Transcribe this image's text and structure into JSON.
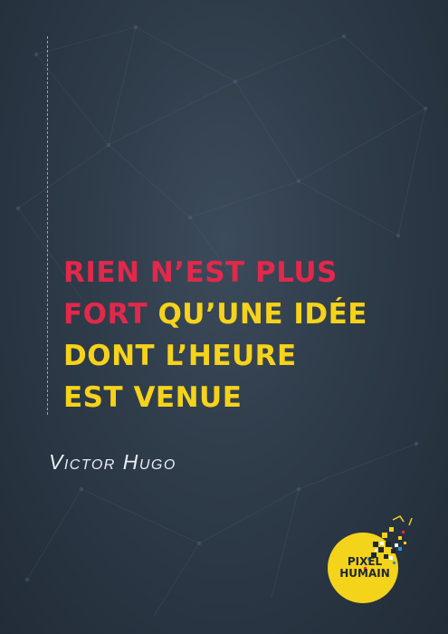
{
  "quote": {
    "line1_red": "RIEN N’EST PLUS",
    "line2_red": "FORT",
    "line2_yellow": " QU’UNE IDÉE",
    "line3_yellow": "DONT L’HEURE",
    "line4_yellow": "EST VENUE"
  },
  "author": "Victor Hugo",
  "logo": {
    "line1": "PIXEL",
    "line2": "HUMAIN"
  },
  "colors": {
    "background": "#2e3b49",
    "accent_red": "#e2284b",
    "accent_yellow": "#f6d31a",
    "author_text": "#e9eef3"
  }
}
